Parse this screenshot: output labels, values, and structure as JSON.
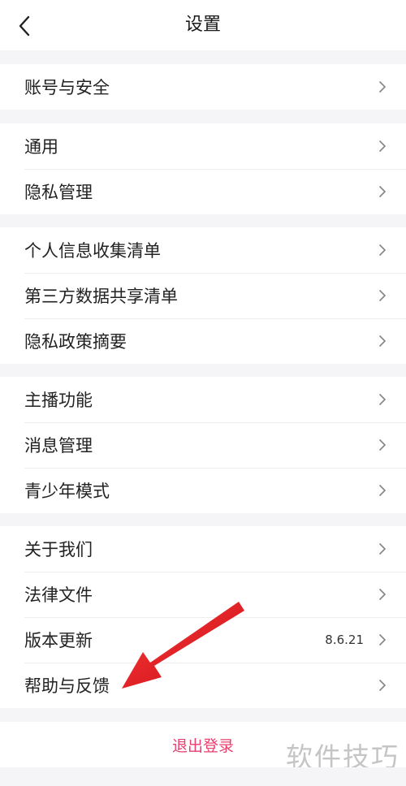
{
  "header": {
    "title": "设置",
    "back_icon": "chevron-left-icon"
  },
  "groups": [
    {
      "items": [
        {
          "label": "账号与安全"
        }
      ]
    },
    {
      "items": [
        {
          "label": "通用"
        },
        {
          "label": "隐私管理"
        }
      ]
    },
    {
      "items": [
        {
          "label": "个人信息收集清单"
        },
        {
          "label": "第三方数据共享清单"
        },
        {
          "label": "隐私政策摘要"
        }
      ]
    },
    {
      "items": [
        {
          "label": "主播功能"
        },
        {
          "label": "消息管理"
        },
        {
          "label": "青少年模式"
        }
      ]
    },
    {
      "items": [
        {
          "label": "关于我们"
        },
        {
          "label": "法律文件"
        },
        {
          "label": "版本更新",
          "value": "8.6.21"
        },
        {
          "label": "帮助与反馈"
        }
      ]
    }
  ],
  "logout": {
    "label": "退出登录"
  },
  "watermark": {
    "text": "软件技巧"
  },
  "colors": {
    "background": "#f5f5f7",
    "accent": "#e83f6f",
    "annotation_arrow": "#e5151d"
  }
}
